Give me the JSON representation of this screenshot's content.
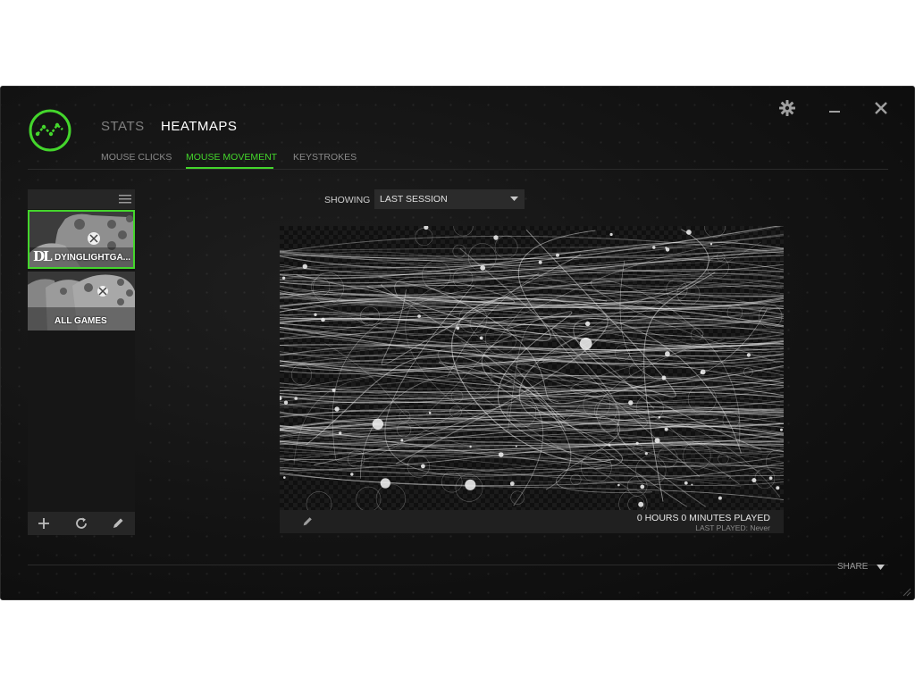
{
  "colors": {
    "accent": "#44d62c",
    "background": "#131313",
    "panel": "#262626"
  },
  "nav": {
    "main_tabs": [
      {
        "label": "STATS",
        "active": false
      },
      {
        "label": "HEATMAPS",
        "active": true
      }
    ],
    "sub_tabs": [
      {
        "label": "MOUSE CLICKS",
        "active": false
      },
      {
        "label": "MOUSE MOVEMENT",
        "active": true
      },
      {
        "label": "KEYSTROKES",
        "active": false
      }
    ]
  },
  "window_controls": {
    "settings_icon": "gear-icon",
    "minimize_icon": "minimize-icon",
    "close_icon": "close-icon"
  },
  "sidebar": {
    "menu_icon": "hamburger-icon",
    "games": [
      {
        "label": "DYINGLIGHTGA...",
        "logo": "DL",
        "selected": true
      },
      {
        "label": "ALL GAMES",
        "selected": false
      }
    ],
    "footer_icons": [
      "plus-icon",
      "refresh-icon",
      "pencil-icon"
    ]
  },
  "showing": {
    "label": "SHOWING",
    "selected": "LAST SESSION"
  },
  "heatmap": {
    "time_played": "0 HOURS 0 MINUTES PLAYED",
    "last_played": "LAST PLAYED: Never",
    "edit_icon": "pencil-icon"
  },
  "footer": {
    "share_label": "SHARE"
  }
}
